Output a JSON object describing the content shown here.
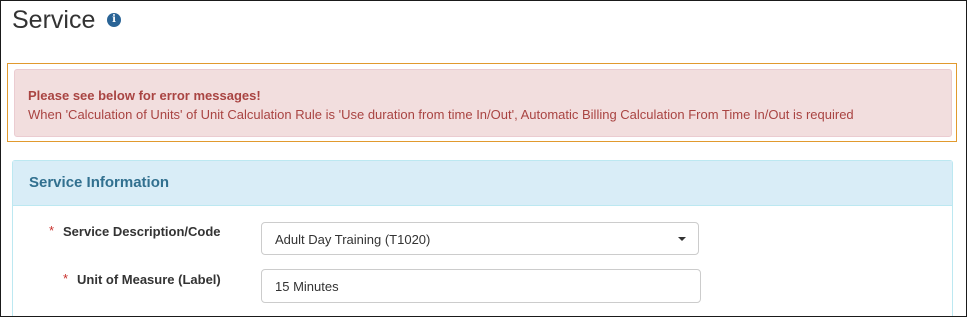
{
  "page": {
    "title": "Service",
    "info_icon": "info-circle-icon"
  },
  "alert": {
    "title": "Please see below for error messages!",
    "message": "When 'Calculation of Units' of Unit Calculation Rule is 'Use duration from time In/Out', Automatic Billing Calculation From Time In/Out is required",
    "text_color": "#a94442",
    "background": "#f2dede",
    "outline_color": "#e19a2e"
  },
  "panel": {
    "title": "Service Information",
    "heading_color": "#d9edf7",
    "title_color": "#31708f"
  },
  "fields": {
    "required_marker": "*",
    "service_description": {
      "label": "Service Description/Code",
      "value": "Adult Day Training (T1020)",
      "icon": "chevron-down-icon"
    },
    "unit_of_measure": {
      "label": "Unit of Measure (Label)",
      "value": "15 Minutes"
    }
  }
}
